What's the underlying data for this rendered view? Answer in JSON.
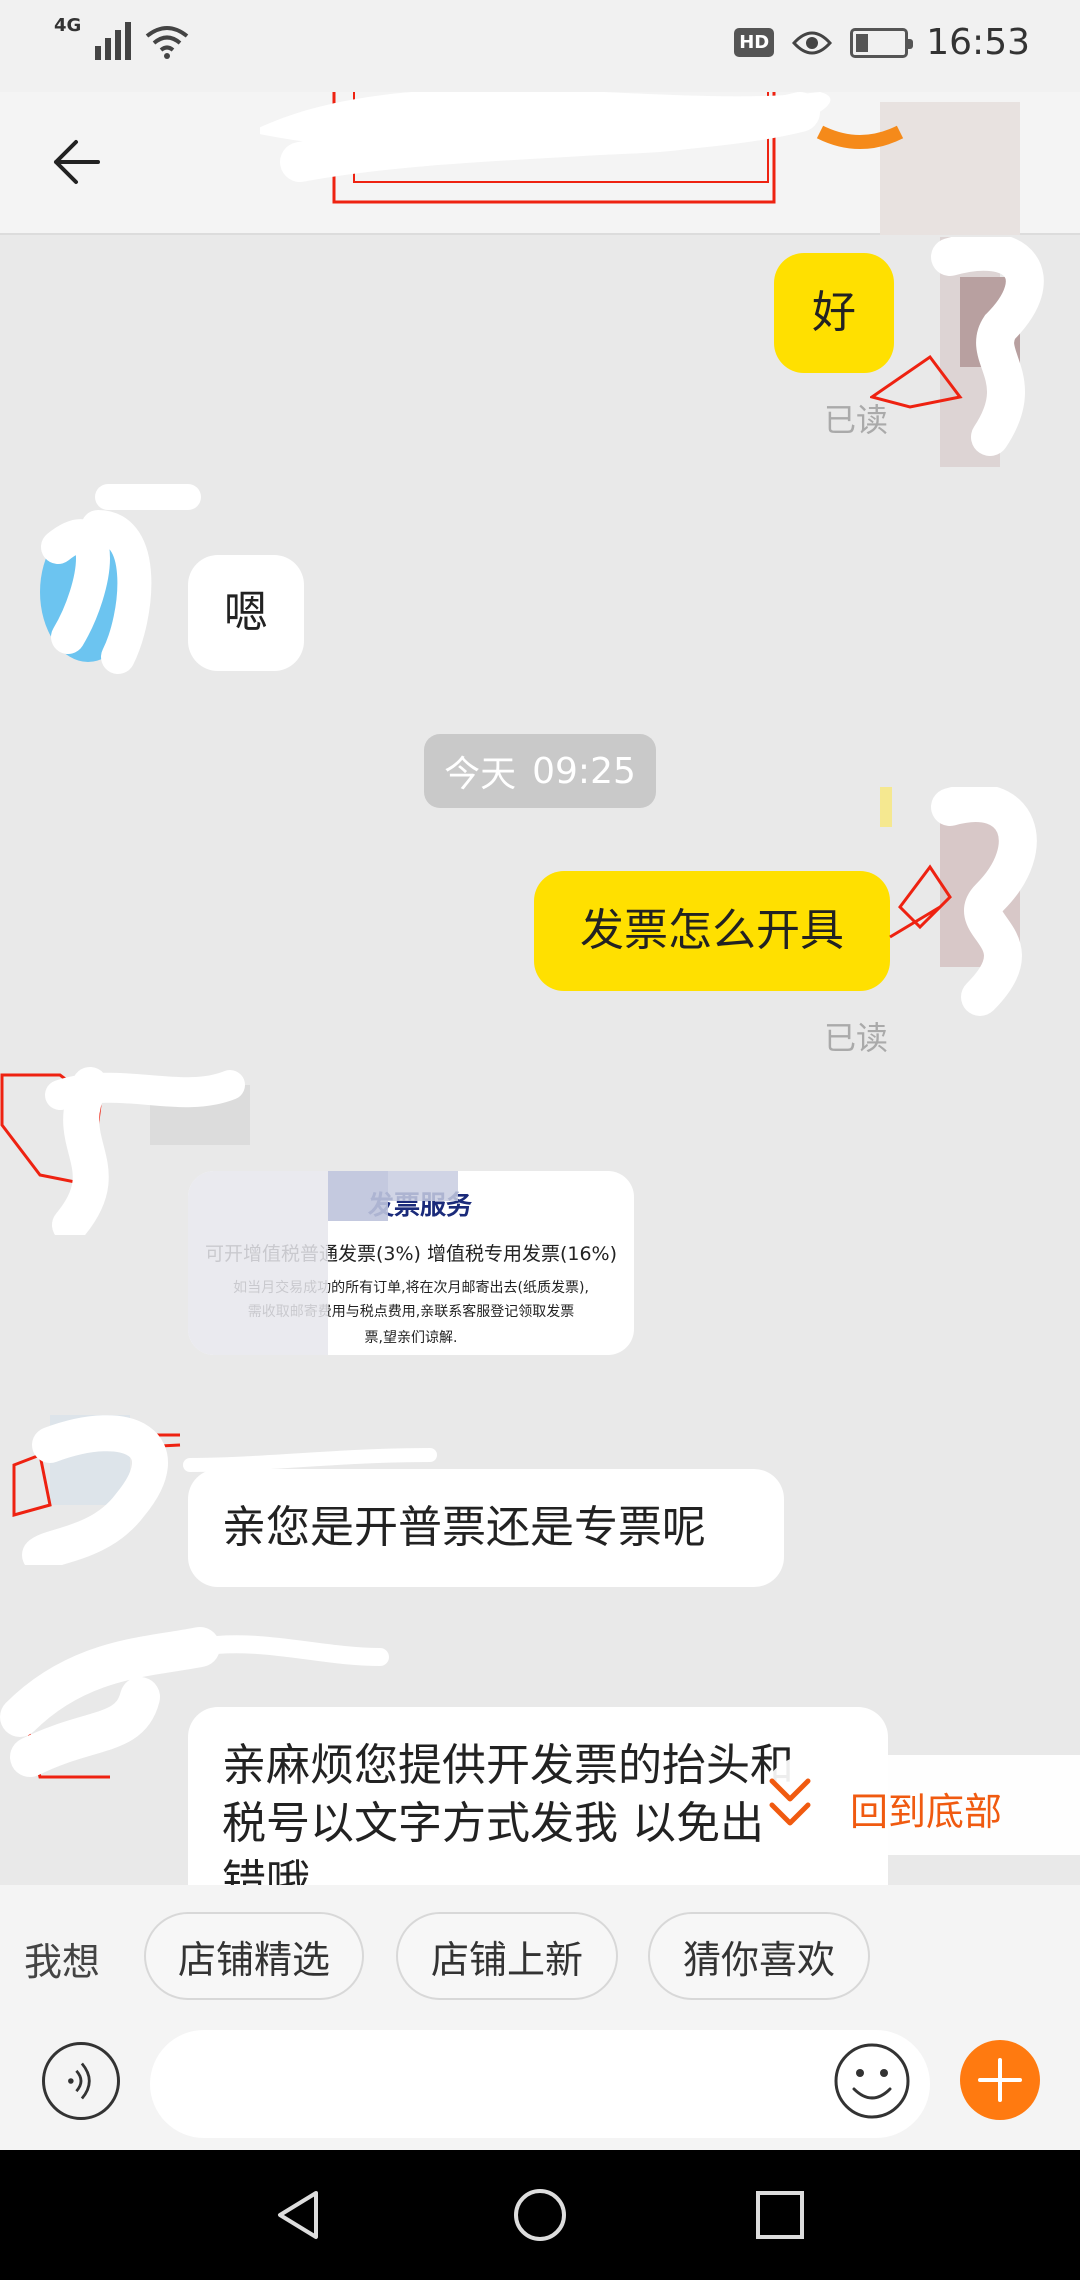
{
  "status_bar": {
    "network": "4G",
    "time": "16:53",
    "hd": "HD"
  },
  "messages": {
    "m1_text": "好",
    "m1_read": "已读",
    "m2_text": "嗯",
    "date_day": "今天",
    "date_time": "09:25",
    "m3_text": "发票怎么开具",
    "m3_read": "已读",
    "card": {
      "title": "发票服务",
      "line1": "可开增值税普通发票(3%) 增值税专用发票(16%)",
      "line2": "如当月交易成功的所有订单,将在次月邮寄出去(纸质发票),",
      "line3": "需收取邮寄费用与税点费用,亲联系客服登记领取发票",
      "line4": "票,望亲们谅解."
    },
    "m4_text": "亲您是开普票还是专票呢",
    "m5_line1": "亲麻烦您提供开发票的抬头和",
    "m5_line2": "税号以文字方式发我 以免出",
    "m5_line3": "错哦"
  },
  "back_to_bottom": "回到底部",
  "quick_bar": {
    "label": "我想",
    "chips": [
      "店铺精选",
      "店铺上新",
      "猜你喜欢"
    ]
  },
  "input_bar": {
    "placeholder": ""
  },
  "colors": {
    "accent_orange": "#ff7a10",
    "my_bubble": "#ffe000",
    "back_to_bottom_text": "#f05a10"
  },
  "icons": {
    "back": "arrow-left-icon",
    "voice": "voice-icon",
    "emoji": "emoji-icon",
    "plus": "plus-icon"
  }
}
